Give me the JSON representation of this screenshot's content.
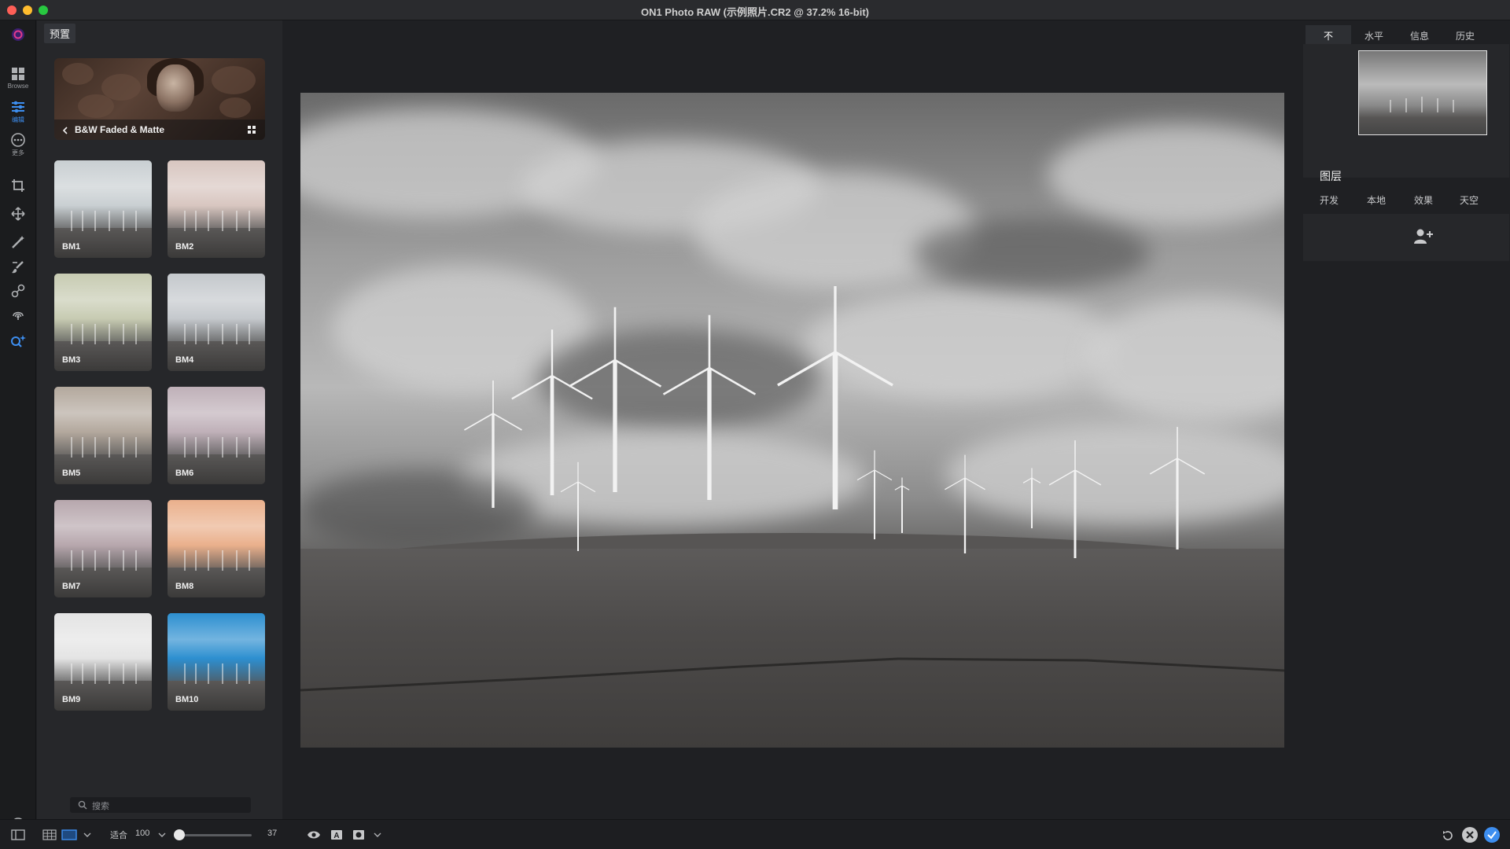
{
  "window": {
    "title": "ON1 Photo RAW (示例照片.CR2 @ 37.2% 16-bit)"
  },
  "left_toolbar": {
    "browse_label": "Browse",
    "edit_label": "编辑",
    "more_label": "更多"
  },
  "presets": {
    "tab_label": "预置",
    "category_title": "B&W Faded & Matte",
    "items": [
      {
        "label": "BM1",
        "tint": "#c9cfd2"
      },
      {
        "label": "BM2",
        "tint": "#d8c6c0"
      },
      {
        "label": "BM3",
        "tint": "#c7cbb2"
      },
      {
        "label": "BM4",
        "tint": "#c4c8cc"
      },
      {
        "label": "BM5",
        "tint": "#b3a89d"
      },
      {
        "label": "BM6",
        "tint": "#bfb0b8"
      },
      {
        "label": "BM7",
        "tint": "#b7a7ad"
      },
      {
        "label": "BM8",
        "tint": "#eab08c"
      },
      {
        "label": "BM9",
        "tint": "#e4e4e4"
      },
      {
        "label": "BM10",
        "tint": "#2d8fd0"
      }
    ],
    "search_placeholder": "搜索"
  },
  "right_panel": {
    "tabs": [
      "不",
      "水平",
      "信息",
      "历史"
    ],
    "layers_title": "图层",
    "layer_tabs": [
      "开发",
      "本地",
      "效果",
      "天空"
    ]
  },
  "bottom_bar": {
    "fit_label": "适合",
    "zoom_value": "100",
    "slider_value": "37"
  },
  "colors": {
    "accent": "#3d8ef0",
    "panel": "#26272a",
    "background": "#1f2023"
  }
}
